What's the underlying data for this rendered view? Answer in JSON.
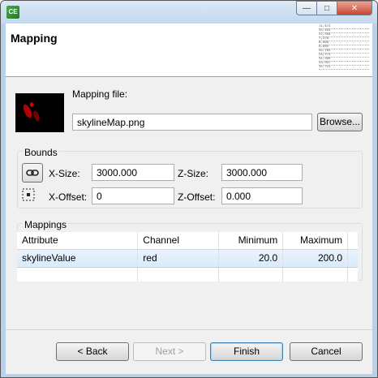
{
  "window": {
    "app_icon_text": "CE"
  },
  "header": {
    "title": "Mapping",
    "preview_lines": [
      "11,673",
      "15,402",
      "17,356",
      "7,378",
      "8,996",
      "9,680",
      "10,784",
      "13,473",
      "11,395",
      "13,097",
      "15,721"
    ]
  },
  "mapping_file": {
    "label": "Mapping file:",
    "value": "skylineMap.png",
    "browse_label": "Browse..."
  },
  "bounds": {
    "title": "Bounds",
    "x_size_label": "X-Size:",
    "x_size": "3000.000",
    "z_size_label": "Z-Size:",
    "z_size": "3000.000",
    "x_offset_label": "X-Offset:",
    "x_offset": "0",
    "z_offset_label": "Z-Offset:",
    "z_offset": "0.000"
  },
  "mappings": {
    "title": "Mappings",
    "columns": [
      "Attribute",
      "Channel",
      "Minimum",
      "Maximum"
    ],
    "rows": [
      {
        "attribute": "skylineValue",
        "channel": "red",
        "minimum": "20.0",
        "maximum": "200.0"
      }
    ]
  },
  "footer": {
    "back": "< Back",
    "next": "Next >",
    "finish": "Finish",
    "cancel": "Cancel"
  },
  "colors": {
    "title_bar": "#c4d8ee",
    "selection": "#d9ebfc",
    "close_button": "#c8452f"
  }
}
